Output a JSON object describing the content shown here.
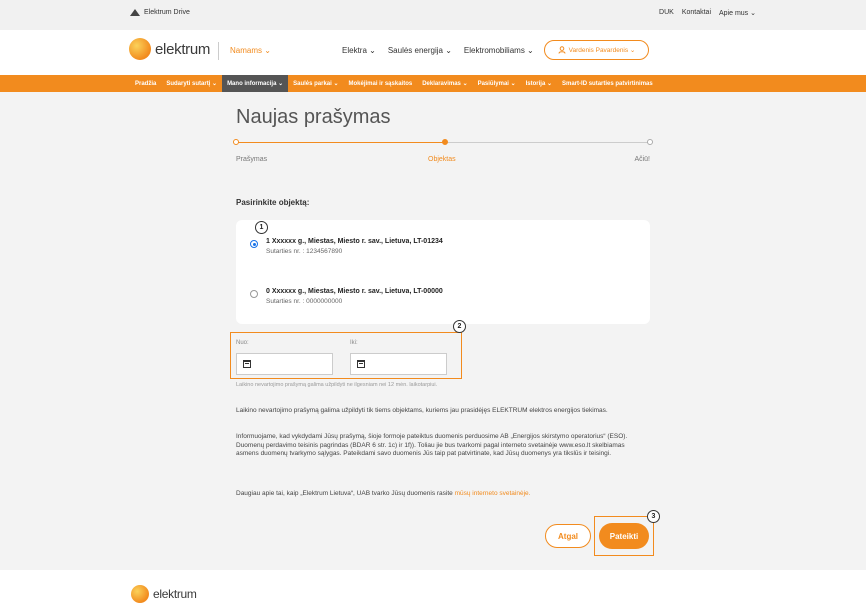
{
  "topbar": {
    "brand": "Elektrum Drive",
    "links": [
      "DUK",
      "Kontaktai",
      "Apie mus ⌄"
    ]
  },
  "header": {
    "logo": "elektrum",
    "segment": "Namams ⌄",
    "nav": [
      "Elektra ⌄",
      "Saulės energija ⌄",
      "Elektromobiliams ⌄"
    ],
    "user": "Vardenis Pavardenis ⌄"
  },
  "orangebar": [
    "Pradžia",
    "Sudaryti sutartį ⌄",
    "Mano informacija ⌄",
    "Saulės parkai ⌄",
    "Mokėjimai ir sąskaitos",
    "Deklaravimas ⌄",
    "Pasiūlymai ⌄",
    "Istorija ⌄",
    "Smart-ID sutarties patvirtinimas"
  ],
  "page": {
    "title": "Naujas prašymas"
  },
  "steps": [
    "Prašymas",
    "Objektas",
    "Ačiū!"
  ],
  "select_label": "Pasirinkite objektą:",
  "objects": [
    {
      "address": "1 Xxxxxx g., Miestas, Miesto r. sav., Lietuva, LT-01234",
      "contract": "Sutarties nr. : 1234567890",
      "selected": true
    },
    {
      "address": "0 Xxxxxx g., Miestas, Miesto r. sav., Lietuva, LT-00000",
      "contract": "Sutarties nr. : 0000000000",
      "selected": false
    }
  ],
  "dates": {
    "from_label": "Nuo:",
    "to_label": "Iki:",
    "from_value": "",
    "to_value": ""
  },
  "hint": "Laikino nevartojimo prašymą galima užpildyti ne ilgesniam nei 12 mėn. laikotarpiui.",
  "paragraphs": {
    "p1": "Laikino nevartojimo prašymą galima užpildyti tik tiems objektams, kuriems jau prasidėjęs ELEKTRUM elektros energijos tiekimas.",
    "p2": "Informuojame, kad vykdydami Jūsų prašymą, šioje formoje pateiktus duomenis perduosime AB „Energijos skirstymo operatorius“ (ESO). Duomenų perdavimo teisinis pagrindas (BDAR 6 str. 1c) ir 1f)). Toliau jie bus tvarkomi pagal interneto svetainėje www.eso.lt skelbiamas asmens duomenų tvarkymo sąlygas. Pateikdami savo duomenis Jūs taip pat patvirtinate, kad Jūsų duomenys yra tikslūs ir teisingi.",
    "p3": "Daugiau apie tai, kaip „Elektrum Lietuva“, UAB tvarko Jūsų duomenis rasite ",
    "p3_link": "mūsų interneto svetainėje."
  },
  "buttons": {
    "back": "Atgal",
    "submit": "Pateikti"
  },
  "badges": [
    "1",
    "2",
    "3"
  ],
  "footer": {
    "logo": "elektrum"
  },
  "colors": {
    "accent": "#f28b1e",
    "dark_tab": "#555555",
    "bg": "#f3f3f3"
  }
}
